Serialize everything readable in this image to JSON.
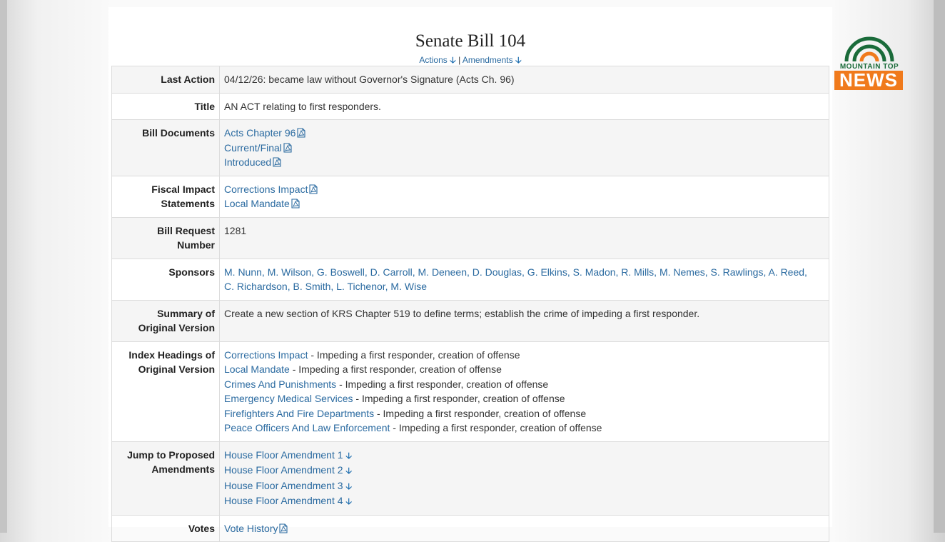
{
  "title": "Senate Bill 104",
  "nav": {
    "actions": "Actions",
    "separator": "|",
    "amendments": "Amendments"
  },
  "rows": {
    "last_action": {
      "label": "Last Action",
      "value": "04/12/26: became law without Governor's Signature (Acts Ch. 96)"
    },
    "title": {
      "label": "Title",
      "value": "AN ACT relating to first responders."
    },
    "bill_documents": {
      "label": "Bill Documents",
      "links": [
        "Acts Chapter 96",
        "Current/Final",
        "Introduced"
      ]
    },
    "fiscal": {
      "label1": "Fiscal Impact",
      "label2": "Statements",
      "links": [
        "Corrections Impact",
        "Local Mandate"
      ]
    },
    "bill_request": {
      "label1": "Bill Request",
      "label2": "Number",
      "value": "1281"
    },
    "sponsors": {
      "label": "Sponsors",
      "line1": "M. Nunn, M. Wilson, G. Boswell, D. Carroll, M. Deneen, D. Douglas, G. Elkins, S. Madon, R. Mills, M. Nemes, S. Rawlings, A. Reed,",
      "line2": "C. Richardson, B. Smith, L. Tichenor, M. Wise"
    },
    "summary": {
      "label1": "Summary of",
      "label2": "Original Version",
      "value": "Create a new section of KRS Chapter 519 to define terms; establish the crime of impeding a first responder."
    },
    "index": {
      "label1": "Index Headings of",
      "label2": "Original Version",
      "items": [
        {
          "link": "Corrections Impact",
          "text": " - Impeding a first responder, creation of offense"
        },
        {
          "link": "Local Mandate",
          "text": " - Impeding a first responder, creation of offense"
        },
        {
          "link": "Crimes And Punishments",
          "text": " - Impeding a first responder, creation of offense"
        },
        {
          "link": "Emergency Medical Services",
          "text": " - Impeding a first responder, creation of offense"
        },
        {
          "link": "Firefighters And Fire Departments",
          "text": " - Impeding a first responder, creation of offense"
        },
        {
          "link": "Peace Officers And Law Enforcement",
          "text": " - Impeding a first responder, creation of offense"
        }
      ]
    },
    "jump": {
      "label1": "Jump to Proposed",
      "label2": "Amendments",
      "links": [
        "House Floor Amendment 1",
        "House Floor Amendment 2",
        "House Floor Amendment 3",
        "House Floor Amendment 4"
      ]
    },
    "votes": {
      "label": "Votes",
      "link": "Vote History"
    }
  },
  "logo": {
    "line1": "MOUNTAIN TOP",
    "line2": "NEWS",
    "colors": {
      "green": "#1a6b3a",
      "orange": "#f07a1c"
    }
  },
  "colors": {
    "link": "#2a6aa0",
    "arrow": "#1f6fb0",
    "shade": "#f5f5f5"
  }
}
